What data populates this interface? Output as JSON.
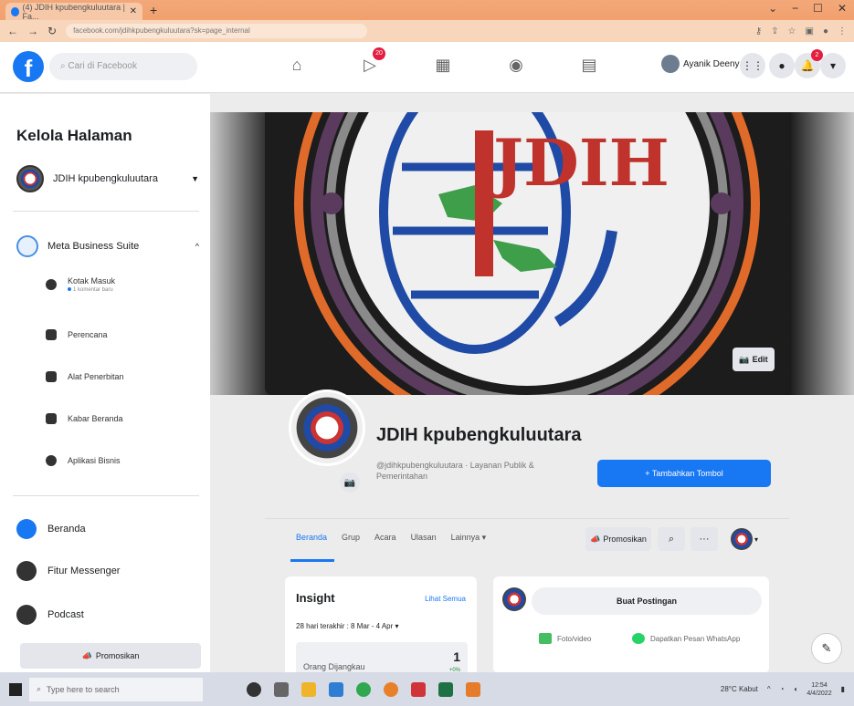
{
  "browser": {
    "tab_title": "(4) JDIH kpubengkuluutara | Fa...",
    "url": "facebook.com/jdihkpubengkuluutara?sk=page_internal"
  },
  "fb_nav": {
    "search_placeholder": "Cari di Facebook",
    "messenger_badge": "20",
    "user_name": "Ayanik Deeny",
    "notifications_badge": "2"
  },
  "sidebar": {
    "title": "Kelola Halaman",
    "page_name": "JDIH kpubengkuluutara",
    "meta_business_suite": "Meta Business Suite",
    "sub_items": [
      {
        "label": "Kotak Masuk",
        "sub": "1 komentar baru"
      },
      {
        "label": "Perencana"
      },
      {
        "label": "Alat Penerbitan"
      },
      {
        "label": "Kabar Beranda"
      },
      {
        "label": "Aplikasi Bisnis"
      }
    ],
    "main_items": [
      {
        "label": "Beranda"
      },
      {
        "label": "Fitur Messenger"
      },
      {
        "label": "Podcast"
      }
    ],
    "promo_button": "Promosikan"
  },
  "cover": {
    "edit_label": "Edit"
  },
  "page_header": {
    "name": "JDIH kpubengkuluutara",
    "subtitle": "@jdihkpubengkuluutara · Layanan Publik & Pemerintahan",
    "add_button": "+ Tambahkan Tombol"
  },
  "tabs": {
    "items": [
      "Beranda",
      "Grup",
      "Acara",
      "Ulasan",
      "Lainnya ▾"
    ],
    "promote": "Promosikan"
  },
  "insight": {
    "title": "Insight",
    "see_all": "Lihat Semua",
    "period": "28 hari terakhir : 8 Mar - 4 Apr ▾",
    "metric_label": "Orang Dijangkau",
    "metric_value": "1",
    "metric_delta": "+0%"
  },
  "post": {
    "prompt": "Buat Postingan",
    "photo_video": "Foto/video",
    "whatsapp": "Dapatkan Pesan WhatsApp"
  },
  "taskbar": {
    "search_placeholder": "Type here to search",
    "weather": "28°C Kabut",
    "time": "12:54",
    "date": "4/4/2022"
  },
  "colors": {
    "fb_blue": "#1877f2",
    "badge_red": "#e41e3f",
    "tab_orange": "#f2a06c"
  }
}
